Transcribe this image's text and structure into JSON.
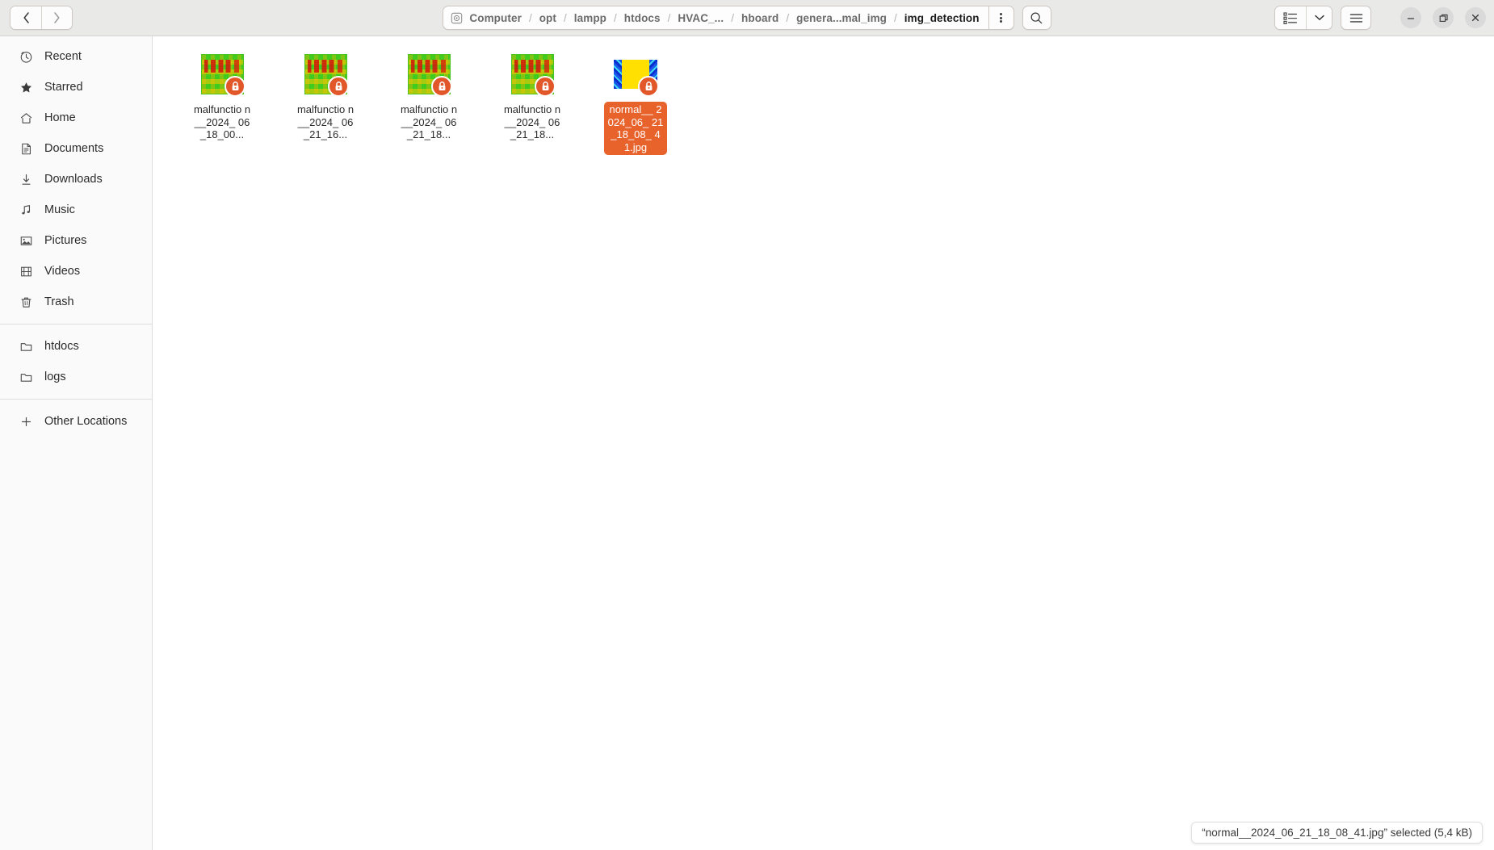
{
  "window": {
    "title": "img_detection",
    "controls": {
      "minimize": "minimize-button",
      "maximize": "maximize-button",
      "close": "close-button"
    }
  },
  "header": {
    "nav": {
      "back_label": "‹",
      "forward_label": "›",
      "back_name": "Back",
      "forward_name": "Forward"
    },
    "pathbar": {
      "drive_icon": "disk-icon",
      "separator": "/",
      "crumbs": [
        {
          "label": "Computer",
          "current": false
        },
        {
          "label": "opt",
          "current": false
        },
        {
          "label": "lampp",
          "current": false
        },
        {
          "label": "htdocs",
          "current": false
        },
        {
          "label": "HVAC_...",
          "current": false
        },
        {
          "label": "hboard",
          "current": false
        },
        {
          "label": "genera...mal_img",
          "current": false
        },
        {
          "label": "img_detection",
          "current": true
        }
      ]
    },
    "buttons": {
      "path_menu": "path-options-menu",
      "search": "search-button",
      "view_list": "view-list-button",
      "view_dropdown": "view-options-dropdown",
      "main_menu": "main-menu-button"
    }
  },
  "sidebar": {
    "groups": [
      {
        "items": [
          {
            "label": "Recent",
            "icon": "clock-icon"
          },
          {
            "label": "Starred",
            "icon": "star-icon"
          },
          {
            "label": "Home",
            "icon": "home-icon"
          },
          {
            "label": "Documents",
            "icon": "document-icon"
          },
          {
            "label": "Downloads",
            "icon": "download-icon"
          },
          {
            "label": "Music",
            "icon": "music-note-icon"
          },
          {
            "label": "Pictures",
            "icon": "picture-icon"
          },
          {
            "label": "Videos",
            "icon": "film-icon"
          },
          {
            "label": "Trash",
            "icon": "trash-icon"
          }
        ]
      },
      {
        "items": [
          {
            "label": "htdocs",
            "icon": "folder-icon"
          },
          {
            "label": "logs",
            "icon": "folder-icon"
          }
        ]
      },
      {
        "items": [
          {
            "label": "Other Locations",
            "icon": "plus-icon"
          }
        ]
      }
    ]
  },
  "files": [
    {
      "name": "malfunctio\nn__2024_\n06_18_00...",
      "thumb": "malfunction",
      "badge": "lock-icon",
      "selected": false
    },
    {
      "name": "malfunctio\nn__2024_\n06_21_16...",
      "thumb": "malfunction",
      "badge": "lock-icon",
      "selected": false
    },
    {
      "name": "malfunctio\nn__2024_\n06_21_18...",
      "thumb": "malfunction",
      "badge": "lock-icon",
      "selected": false
    },
    {
      "name": "malfunctio\nn__2024_\n06_21_18...",
      "thumb": "malfunction",
      "badge": "lock-icon",
      "selected": false
    },
    {
      "name": "normal__\n2024_06_\n21_18_08_\n41.jpg",
      "thumb": "normal",
      "badge": "lock-icon",
      "selected": true
    }
  ],
  "statusbar": {
    "text": "“normal__2024_06_21_18_08_41.jpg” selected  (5,4 kB)"
  },
  "colors": {
    "selection": "#e8622b",
    "header_bg": "#e9e9e8",
    "sidebar_bg": "#fafafa",
    "lock_badge": "#e2572a"
  }
}
